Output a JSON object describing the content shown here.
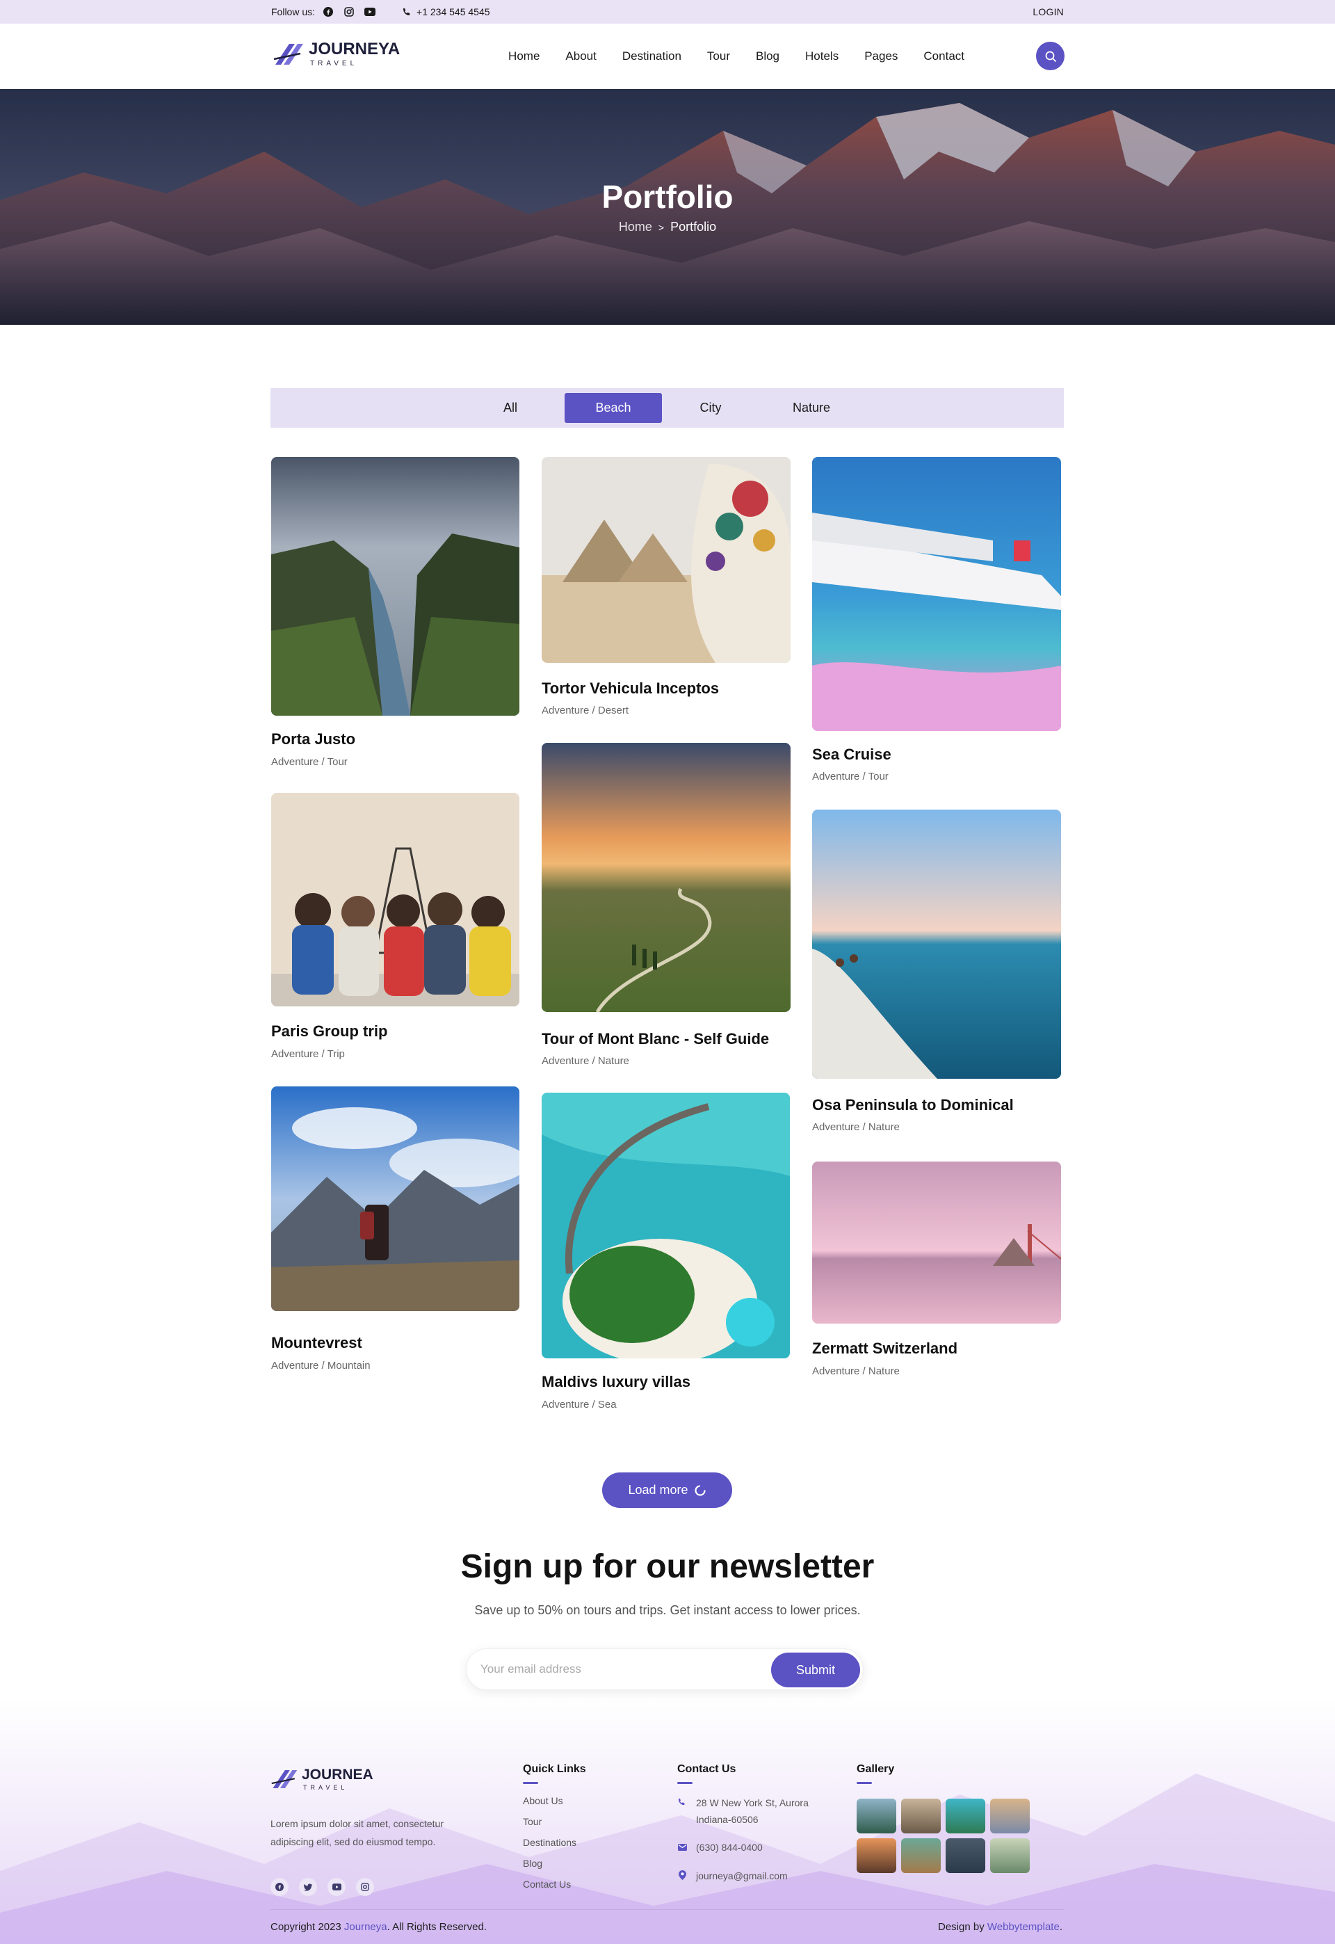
{
  "topbar": {
    "follow_label": "Follow us:",
    "socials": [
      "facebook-icon",
      "instagram-icon",
      "youtube-icon"
    ],
    "phone": "+1 234 545 4545",
    "login": "LOGIN"
  },
  "brand": {
    "name": "JOURNEYA",
    "tagline": "TRAVEL"
  },
  "nav": {
    "items": [
      "Home",
      "About",
      "Destination",
      "Tour",
      "Blog",
      "Hotels",
      "Pages",
      "Contact"
    ]
  },
  "hero": {
    "title": "Portfolio",
    "crumb_home": "Home",
    "crumb_sep": ">",
    "crumb_current": "Portfolio"
  },
  "filters": {
    "items": [
      "All",
      "Beach",
      "City",
      "Nature"
    ],
    "active": "Beach"
  },
  "portfolio": [
    {
      "title": "Porta Justo",
      "category": "Adventure / Tour"
    },
    {
      "title": "Paris Group trip",
      "category": "Adventure / Trip"
    },
    {
      "title": "Mountevrest",
      "category": "Adventure / Mountain"
    },
    {
      "title": "Tortor Vehicula Inceptos",
      "category": "Adventure / Desert"
    },
    {
      "title": "Tour of Mont Blanc - Self Guide",
      "category": "Adventure / Nature"
    },
    {
      "title": "Maldivs luxury villas",
      "category": "Adventure / Sea"
    },
    {
      "title": "Sea Cruise",
      "category": "Adventure / Tour"
    },
    {
      "title": "Osa Peninsula to Dominical",
      "category": "Adventure / Nature"
    },
    {
      "title": "Zermatt Switzerland",
      "category": "Adventure / Nature"
    }
  ],
  "load_more": "Load more",
  "newsletter": {
    "title": "Sign up for our newsletter",
    "subtitle": "Save up to 50% on tours and trips. Get instant access to lower prices.",
    "placeholder": "Your email address",
    "submit": "Submit"
  },
  "footer": {
    "brand": "JOURNEA",
    "tagline": "TRAVEL",
    "description": "Lorem ipsum dolor sit amet, consectetur adipiscing elit, sed do eiusmod tempo.",
    "socials": [
      "facebook-icon",
      "twitter-icon",
      "youtube-icon",
      "instagram-icon"
    ],
    "quick_links_title": "Quick Links",
    "quick_links": [
      "About Us",
      "Tour",
      "Destinations",
      "Blog",
      "Contact Us"
    ],
    "contact_title": "Contact Us",
    "address_line1": "28 W New York St, Aurora",
    "address_line2": "Indiana-60506",
    "phone": "(630) 844-0400",
    "email": "journeya@gmail.com",
    "gallery_title": "Gallery",
    "copyright_pre": "Copyright 2023 ",
    "copyright_brand": "Journeya",
    "copyright_post": ". All Rights Reserved.",
    "design_pre": "Design by ",
    "design_brand": "Webbytemplate",
    "design_post": "."
  },
  "colors": {
    "accent": "#5b52c4",
    "topbar_bg": "#e9e3f5",
    "filter_bg": "#e6e0f4"
  }
}
